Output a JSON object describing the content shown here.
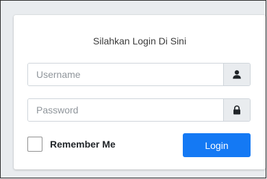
{
  "login": {
    "title": "Silahkan Login Di Sini",
    "username_placeholder": "Username",
    "username_value": "",
    "password_placeholder": "Password",
    "password_value": "",
    "remember_label": "Remember Me",
    "remember_checked": false,
    "button_label": "Login",
    "icons": {
      "username": "user-icon",
      "password": "lock-icon"
    },
    "colors": {
      "button": "#1479f4",
      "addon_bg": "#e9ecef"
    }
  }
}
